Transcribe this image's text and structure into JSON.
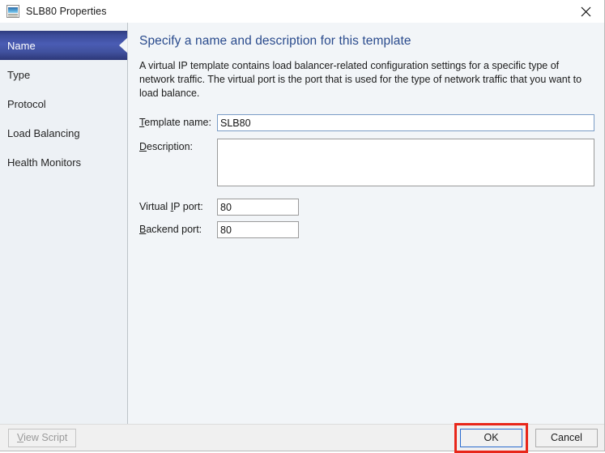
{
  "window": {
    "title": "SLB80 Properties",
    "icon": "template-window-icon",
    "close_label": "✕",
    "accent_blue": "#2a4b8d",
    "selected_nav_blue": "#3b4b98",
    "highlight_red": "#e8261a"
  },
  "sidebar": {
    "items": [
      {
        "label": "Name",
        "selected": true
      },
      {
        "label": "Type",
        "selected": false
      },
      {
        "label": "Protocol",
        "selected": false
      },
      {
        "label": "Load Balancing",
        "selected": false
      },
      {
        "label": "Health Monitors",
        "selected": false
      }
    ]
  },
  "main": {
    "heading": "Specify a name and description for this template",
    "description": "A virtual IP template contains load balancer-related configuration settings for a specific type of network traffic. The virtual port is the port that is used for the type of network traffic that you want to load balance.",
    "fields": {
      "template_name": {
        "label_prefix": "",
        "label_accel": "T",
        "label_rest": "emplate name:",
        "value": "SLB80",
        "placeholder": ""
      },
      "description_box": {
        "label_accel": "D",
        "label_rest": "escription:",
        "value": "",
        "placeholder": ""
      },
      "virtual_ip_port": {
        "label_prefix": "Virtual ",
        "label_accel": "I",
        "label_rest": "P port:",
        "value": "80",
        "placeholder": ""
      },
      "backend_port": {
        "label_prefix": "",
        "label_accel": "B",
        "label_rest": "ackend port:",
        "value": "80",
        "placeholder": ""
      }
    }
  },
  "footer": {
    "view_script": {
      "accel": "V",
      "rest": "iew Script",
      "disabled": true
    },
    "ok_label": "OK",
    "cancel_label": "Cancel"
  }
}
